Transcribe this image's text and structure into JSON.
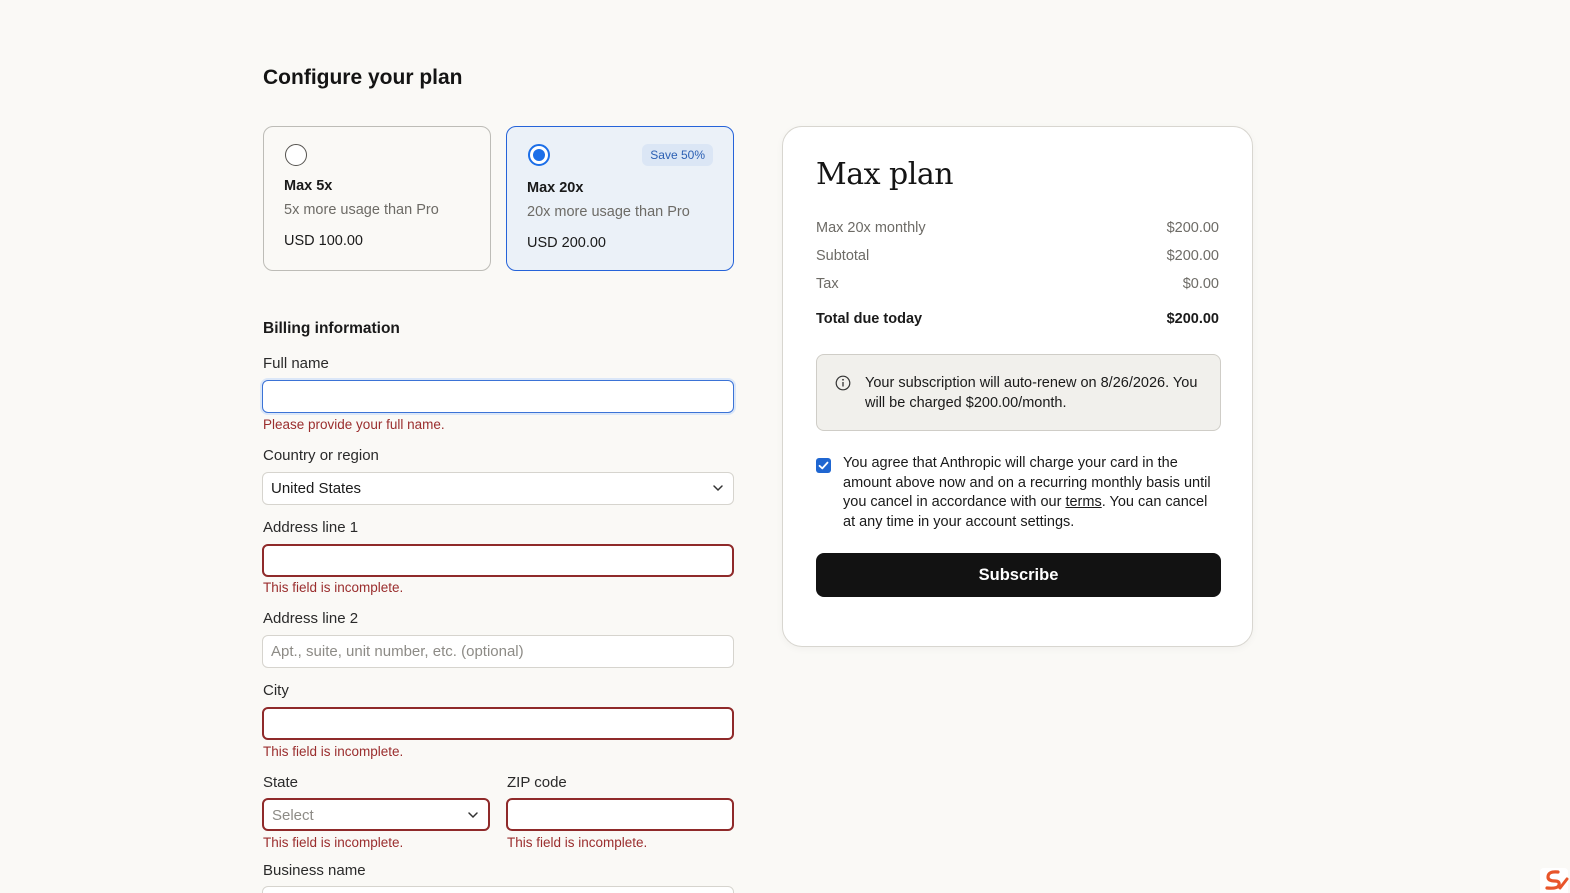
{
  "page": {
    "title": "Configure your plan"
  },
  "plans": [
    {
      "name": "Max 5x",
      "description": "5x more usage than Pro",
      "price": "USD 100.00",
      "selected": false
    },
    {
      "name": "Max 20x",
      "description": "20x more usage than Pro",
      "price": "USD 200.00",
      "selected": true,
      "badge": "Save 50%"
    }
  ],
  "billing": {
    "title": "Billing information",
    "full_name": {
      "label": "Full name",
      "value": "",
      "error": "Please provide your full name."
    },
    "country": {
      "label": "Country or region",
      "value": "United States"
    },
    "address1": {
      "label": "Address line 1",
      "value": "",
      "error": "This field is incomplete."
    },
    "address2": {
      "label": "Address line 2",
      "placeholder": "Apt., suite, unit number, etc. (optional)"
    },
    "city": {
      "label": "City",
      "value": "",
      "error": "This field is incomplete."
    },
    "state": {
      "label": "State",
      "placeholder": "Select",
      "error": "This field is incomplete."
    },
    "zip": {
      "label": "ZIP code",
      "value": "",
      "error": "This field is incomplete."
    },
    "business": {
      "label": "Business name"
    }
  },
  "summary": {
    "title": "Max plan",
    "lines": [
      {
        "label": "Max 20x monthly",
        "amount": "$200.00"
      },
      {
        "label": "Subtotal",
        "amount": "$200.00"
      },
      {
        "label": "Tax",
        "amount": "$0.00"
      }
    ],
    "total": {
      "label": "Total due today",
      "amount": "$200.00"
    },
    "notice": "Your subscription will auto-renew on 8/26/2026. You will be charged $200.00/month.",
    "agreement": {
      "checked": true,
      "before": "You agree that Anthropic will charge your card in the amount above now and on a recurring monthly basis until you cancel in accordance with our ",
      "link": "terms",
      "after": ". You can cancel at any time in your account settings."
    },
    "subscribe_label": "Subscribe"
  },
  "colors": {
    "accent": "#1b6ee8",
    "error": "#9a2d2d",
    "button": "#121212",
    "background": "#faf9f6"
  },
  "icons": {
    "info": "info-icon",
    "chevron": "chevron-down-icon",
    "radio": "radio-icon",
    "checkbox": "checkbox-checked-icon",
    "corner": "app-logo-icon"
  }
}
